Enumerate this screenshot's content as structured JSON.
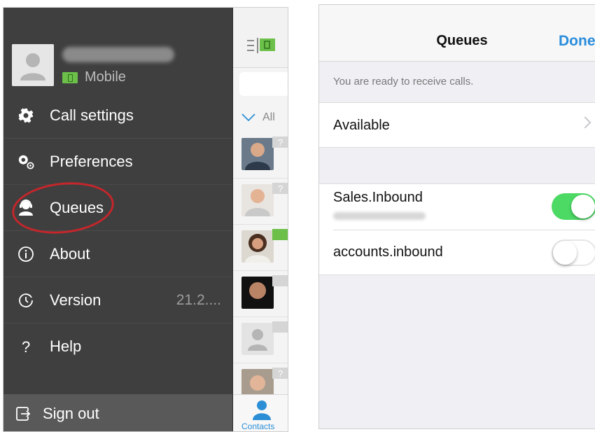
{
  "left_phone": {
    "presence_label": "Mobile",
    "menu": [
      {
        "label": "Call settings",
        "icon": "gear-icon"
      },
      {
        "label": "Preferences",
        "icon": "gears-icon"
      },
      {
        "label": "Queues",
        "icon": "headset-user-icon"
      },
      {
        "label": "About",
        "icon": "info-icon"
      },
      {
        "label": "Version",
        "icon": "clock-icon",
        "value": "21.2...."
      },
      {
        "label": "Help",
        "icon": "question-icon"
      }
    ],
    "sign_out_label": "Sign out",
    "highlight_color": "#c5262b",
    "contacts_strip": {
      "filter_label": "All",
      "tab_label": "Contacts",
      "accent_color": "#2c8fd6"
    }
  },
  "right_phone": {
    "title": "Queues",
    "done_label": "Done",
    "hint": "You are ready to receive calls.",
    "status_label": "Available",
    "queues": [
      {
        "name": "Sales.Inbound",
        "enabled": true
      },
      {
        "name": "accounts.inbound",
        "enabled": false
      }
    ],
    "toggle_on_color": "#4cd964",
    "done_color": "#2a8ddc"
  }
}
